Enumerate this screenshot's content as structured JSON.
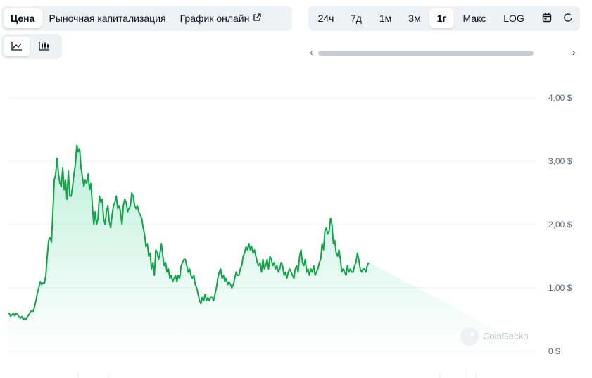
{
  "tabs_left": [
    "Цена",
    "Рыночная капитализация",
    "График онлайн"
  ],
  "tabs_left_active": 0,
  "ranges": [
    "24ч",
    "7д",
    "1м",
    "3м",
    "1г",
    "Макс",
    "LOG"
  ],
  "range_active": 4,
  "icons": {
    "external": "external-link-icon",
    "calendar": "calendar-icon",
    "line": "line-chart-icon",
    "candle": "candlestick-chart-icon",
    "left": "chevron-left-icon",
    "right": "chevron-right-icon"
  },
  "watermark": "CoinGecko",
  "colors": {
    "line": "#16a34a",
    "fill": "#16c784",
    "active_tab_bg": "#ffffff",
    "tab_bg": "#eff2f5"
  },
  "chart_data": {
    "type": "area",
    "ylim": [
      0,
      4
    ],
    "yticks": [
      "4,00 $",
      "3,00 $",
      "2,00 $",
      "1,00 $",
      "0 $"
    ],
    "ytick_values": [
      4,
      3,
      2,
      1,
      0
    ],
    "x_index": [
      0,
      2,
      4,
      6,
      8,
      10,
      12,
      14,
      16,
      18,
      20,
      22,
      24,
      26,
      28,
      30,
      32,
      34,
      36,
      38,
      40,
      42,
      44,
      46,
      48,
      50,
      52,
      54,
      56,
      58,
      60,
      62,
      64,
      66,
      68,
      70,
      72,
      74,
      76,
      78,
      80,
      82,
      84,
      86,
      88,
      90,
      92,
      94,
      96,
      98,
      100,
      102,
      104,
      106,
      108,
      110,
      112,
      114,
      116,
      118,
      120,
      122,
      124,
      126,
      128,
      130,
      132,
      134,
      136,
      138,
      140,
      142,
      144,
      146,
      148,
      150,
      152,
      154,
      156,
      158,
      160,
      162,
      164,
      166,
      168,
      170,
      172,
      174,
      176,
      178,
      180,
      182,
      184,
      186,
      188,
      190,
      192,
      194,
      196,
      198,
      200,
      202,
      204,
      206,
      208,
      210,
      212,
      214,
      216,
      218,
      220,
      222,
      224,
      226,
      228,
      230,
      232,
      234,
      236,
      238,
      240,
      242,
      244,
      246,
      248,
      250,
      252,
      254,
      256,
      258,
      260,
      262,
      264,
      266,
      268,
      270,
      272,
      274,
      276,
      278,
      280,
      282,
      284,
      286,
      288,
      290,
      292,
      294,
      296,
      298,
      300,
      302,
      304,
      306,
      308,
      310,
      312,
      314,
      316,
      318,
      320,
      322,
      324,
      326,
      328,
      330,
      332,
      334,
      336,
      338,
      340,
      342,
      344,
      346,
      348,
      350,
      352,
      354,
      356,
      358,
      360,
      362,
      364,
      366,
      368,
      370,
      372,
      374,
      376,
      378,
      380,
      382,
      384,
      386,
      388,
      390,
      392,
      394,
      396,
      398,
      400,
      402,
      404,
      406,
      408,
      410,
      412,
      414,
      416,
      418,
      420,
      422,
      424,
      426,
      428,
      430,
      432,
      434,
      436,
      438,
      440,
      442,
      444,
      446,
      448,
      450,
      452,
      454,
      456,
      458,
      460,
      462,
      464,
      466,
      468,
      470,
      472,
      474,
      476,
      478,
      480,
      482,
      484,
      486,
      488,
      490,
      492,
      494,
      496,
      498,
      500,
      502,
      504,
      506,
      508,
      510,
      512,
      514,
      516,
      518,
      520,
      522,
      524,
      526,
      528,
      530,
      532,
      534,
      536,
      538,
      540,
      542,
      544,
      546,
      548,
      550,
      552,
      554,
      556,
      558,
      560,
      562,
      564,
      566,
      568,
      570,
      572,
      574,
      576,
      578,
      580,
      582,
      584,
      586,
      588,
      590,
      592,
      594,
      596,
      598,
      600,
      602,
      604,
      606,
      608,
      610,
      612,
      614,
      616,
      618,
      620,
      622,
      624,
      626,
      628,
      630,
      632,
      634,
      636,
      638,
      640,
      642,
      644,
      646,
      648,
      650,
      652,
      654,
      656,
      658,
      660,
      662,
      664,
      666,
      668,
      670,
      672,
      674,
      676,
      678,
      680,
      682,
      684,
      686,
      688,
      690,
      692,
      694,
      696,
      698,
      700,
      702,
      704,
      706,
      708,
      710,
      712,
      714,
      716,
      718,
      720,
      722,
      724,
      726,
      728,
      730,
      732,
      734,
      736,
      738,
      740,
      742,
      744,
      746,
      748,
      750
    ],
    "values": [
      0.6,
      0.6,
      0.55,
      0.58,
      0.6,
      0.56,
      0.6,
      0.58,
      0.54,
      0.52,
      0.55,
      0.5,
      0.52,
      0.5,
      0.54,
      0.58,
      0.62,
      0.64,
      0.63,
      0.7,
      0.8,
      0.92,
      1.0,
      1.1,
      1.05,
      1.08,
      1.07,
      1.2,
      1.5,
      1.75,
      1.8,
      1.72,
      2.2,
      2.7,
      2.8,
      3.05,
      2.8,
      2.65,
      2.6,
      2.9,
      2.55,
      2.7,
      2.4,
      2.85,
      2.45,
      2.45,
      2.6,
      2.8,
      2.95,
      3.25,
      3.15,
      3.2,
      2.9,
      2.75,
      2.6,
      2.7,
      2.65,
      2.8,
      2.55,
      2.65,
      2.3,
      2.0,
      2.2,
      2.0,
      2.1,
      2.45,
      2.35,
      2.4,
      2.1,
      2.0,
      2.2,
      2.3,
      2.05,
      1.95,
      2.15,
      2.3,
      2.35,
      2.45,
      2.25,
      2.3,
      2.2,
      2.0,
      2.3,
      2.4,
      2.35,
      2.2,
      2.25,
      2.3,
      2.5,
      2.45,
      2.3,
      2.25,
      2.3,
      2.2,
      2.15,
      2.1,
      1.95,
      1.85,
      1.65,
      1.7,
      1.5,
      1.55,
      1.3,
      1.4,
      1.2,
      1.6,
      1.55,
      1.45,
      1.55,
      1.7,
      1.5,
      1.35,
      1.4,
      1.25,
      1.3,
      1.15,
      1.2,
      1.1,
      1.15,
      1.2,
      1.1,
      1.2,
      1.15,
      1.35,
      1.4,
      1.45,
      1.45,
      1.35,
      1.25,
      1.3,
      1.2,
      1.15,
      1.2,
      1.05,
      1.0,
      0.9,
      0.8,
      0.75,
      0.85,
      0.8,
      0.9,
      0.8,
      0.85,
      0.8,
      0.85,
      0.85,
      0.8,
      0.9,
      1.0,
      1.15,
      1.25,
      1.3,
      1.15,
      1.2,
      1.1,
      1.15,
      1.05,
      1.1,
      1.05,
      1.0,
      1.05,
      1.15,
      1.25,
      1.2,
      1.2,
      1.3,
      1.35,
      1.5,
      1.55,
      1.65,
      1.6,
      1.7,
      1.6,
      1.65,
      1.55,
      1.6,
      1.5,
      1.4,
      1.35,
      1.4,
      1.25,
      1.45,
      1.3,
      1.35,
      1.45,
      1.3,
      1.5,
      1.45,
      1.35,
      1.4,
      1.3,
      1.35,
      1.25,
      1.3,
      1.4,
      1.35,
      1.2,
      1.25,
      1.15,
      1.25,
      1.3,
      1.25,
      1.2,
      1.15,
      1.3,
      1.35,
      1.25,
      1.5,
      1.6,
      1.4,
      1.35,
      1.45,
      1.25,
      1.3,
      1.2,
      1.3,
      1.25,
      1.35,
      1.2,
      1.25,
      1.3,
      1.4,
      1.45,
      1.7,
      1.6,
      1.9,
      1.95,
      1.85,
      1.9,
      2.1,
      2.0,
      1.7,
      1.75,
      1.55,
      1.5,
      1.6,
      1.45,
      1.25,
      1.3,
      1.25,
      1.2,
      1.35,
      1.25,
      1.3,
      1.25,
      1.25,
      1.35,
      1.4,
      1.55,
      1.45,
      1.3,
      1.25,
      1.3,
      1.3,
      1.25,
      1.35,
      1.4
    ],
    "grid": true
  }
}
